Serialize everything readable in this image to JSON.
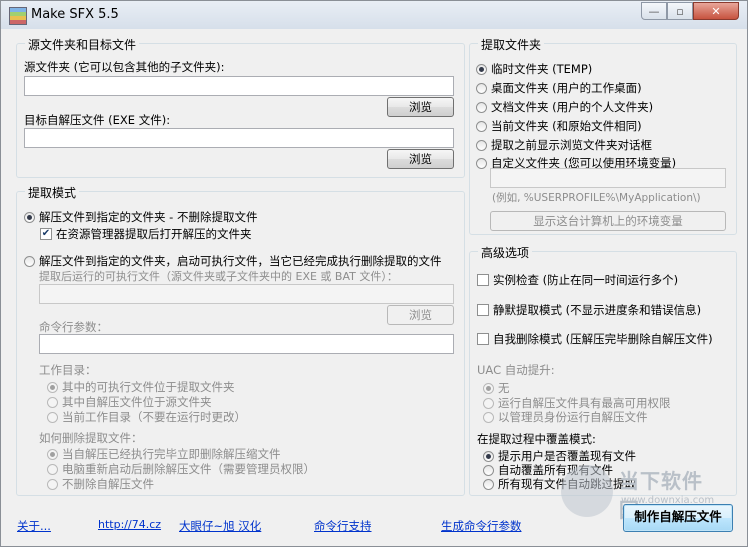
{
  "window": {
    "title": "Make SFX 5.5",
    "min": "—",
    "max": "▫",
    "close": "✕"
  },
  "source_group": {
    "legend": "源文件夹和目标文件",
    "source_label": "源文件夹 (它可以包含其他的子文件夹):",
    "source_value": "",
    "browse1": "浏览",
    "target_label": "目标自解压文件 (EXE 文件):",
    "target_value": "",
    "browse2": "浏览"
  },
  "extract_mode": {
    "legend": "提取模式",
    "opt1": "解压文件到指定的文件夹 - 不删除提取文件",
    "opt1_check": "在资源管理器提取后打开解压的文件夹",
    "opt2": "解压文件到指定的文件夹，启动可执行文件，当它已经完成执行删除提取的文件",
    "exe_label": "提取后运行的可执行文件（源文件夹或子文件夹中的 EXE 或 BAT 文件）：",
    "exe_value": "",
    "browse3": "浏览",
    "cmd_label": "命令行参数：",
    "cmd_value": "",
    "workdir_label": "工作目录：",
    "workdir_opts": [
      "其中的可执行文件位于提取文件夹",
      "其中自解压文件位于源文件夹",
      "当前工作目录（不要在运行时更改）"
    ],
    "delete_label": "如何删除提取文件：",
    "delete_opts": [
      "当自解压已经执行完毕立即删除解压缩文件",
      "电脑重新启动后删除解压文件（需要管理员权限）",
      "不删除自解压文件"
    ]
  },
  "extract_folder": {
    "legend": "提取文件夹",
    "opts": [
      "临时文件夹 (TEMP)",
      "桌面文件夹 (用户的工作桌面)",
      "文档文件夹 (用户的个人文件夹)",
      "当前文件夹 (和原始文件相同)",
      "提取之前显示浏览文件夹对话框",
      "自定义文件夹 (您可以使用环境变量)"
    ],
    "custom_value": "",
    "example": "(例如, %USERPROFILE%\\MyApplication\\)",
    "env_button": "显示这台计算机上的环境变量"
  },
  "advanced": {
    "legend": "高级选项",
    "check1": "实例检查 (防止在同一时间运行多个)",
    "check2": "静默提取模式 (不显示进度条和错误信息)",
    "check3": "自我删除模式 (压解压完毕删除自解压文件)",
    "uac_label": "UAC 自动提升:",
    "uac_opts": [
      "无",
      "运行自解压文件具有最高可用权限",
      "以管理员身份运行自解压文件"
    ],
    "overwrite_label": "在提取过程中覆盖模式:",
    "overwrite_opts": [
      "提示用户是否覆盖现有文件",
      "自动覆盖所有现有文件",
      "所有现有文件自动跳过提取"
    ]
  },
  "footer": {
    "about": "关于...",
    "url": "http://74.cz",
    "translator": "大眼仔~旭 汉化",
    "cmd_support": "命令行支持",
    "gen_cmd": "生成命令行参数",
    "make_button": "制作自解压文件"
  },
  "watermark": {
    "line1": "当下软件园",
    "line2": "www.downxia.com"
  }
}
